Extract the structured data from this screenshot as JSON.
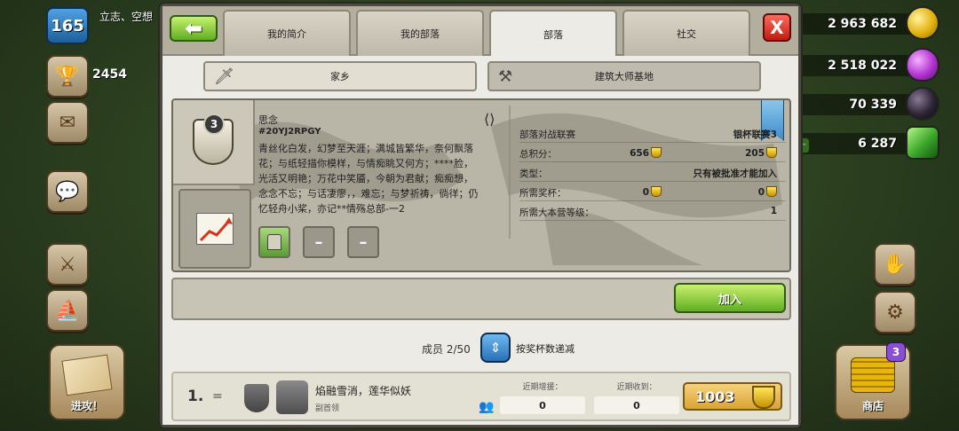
{
  "hud": {
    "level": "165",
    "player_name": "立志、空想",
    "trophies": "2454",
    "gold": "2 963 682",
    "elixir": "2 518 022",
    "dark_elixir": "70 339",
    "gems": "6 287",
    "raid_label": "进攻！",
    "shop_label": "商店",
    "shop_badge": "3"
  },
  "dialog": {
    "back_symbol": "⬅",
    "close_symbol": "X",
    "tabs": [
      {
        "label": "我的简介"
      },
      {
        "label": "我的部落"
      },
      {
        "label": "部落"
      },
      {
        "label": "社交"
      }
    ],
    "active_tab": "部落",
    "sub_tabs": {
      "home": "家乡",
      "builder": "建筑大师基地"
    }
  },
  "clan": {
    "level": "3",
    "name": "思念",
    "tag": "#20YJ2RPGY",
    "description": "青丝化白发，幻梦至天涯；满城皆繁华，奈何飘落花；与纸轻描你模样，与情痴眺又何方；****脸，光活又明艳；万花中笑靥，今朝为君献；痴痴想，念念不忘；与话凄廖，，难忘；与梦祈祷，徜徉；仍忆轻舟小桨，亦记**情殇总部-一2",
    "labels": [
      "",
      "–",
      "–"
    ],
    "stats": {
      "war_league_label": "部落对战联赛",
      "war_league_value": "银杯联赛3",
      "points_label": "总积分：",
      "points_home": "656",
      "points_builder": "205",
      "type_label": "类型：",
      "type_value": "只有被批准才能加入",
      "req_trophies_label": "所需奖杯：",
      "req_trophies_home": "0",
      "req_trophies_builder": "0",
      "req_th_label": "所需大本营等级：",
      "req_th_value": "1"
    },
    "join_label": "加入"
  },
  "members": {
    "count_label": "成员 2/50",
    "sort_label": "按奖杯数递减",
    "rows": [
      {
        "rank": "1.",
        "name": "焰融雪消，莲华似妖",
        "role": "副首领",
        "donated_label": "近期增援：",
        "donated": "0",
        "received_label": "近期收到：",
        "received": "0",
        "trophies": "1003"
      }
    ]
  }
}
